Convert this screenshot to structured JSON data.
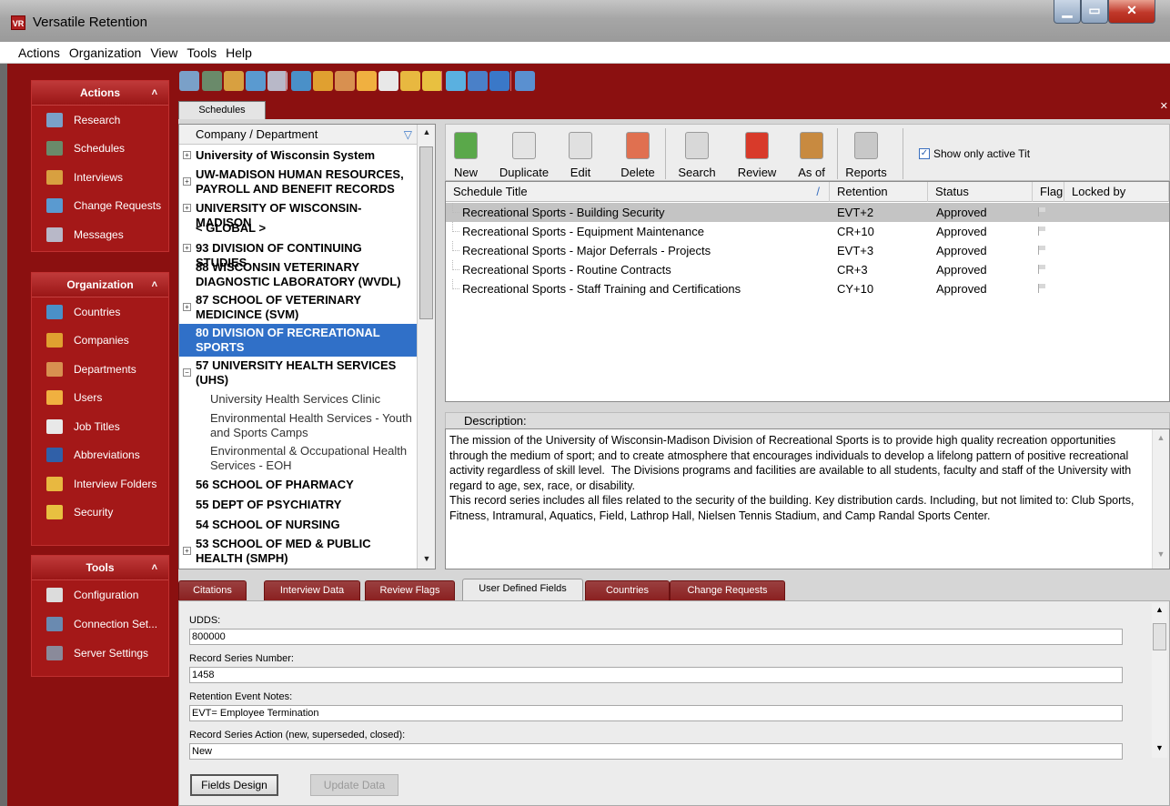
{
  "window": {
    "title": "Versatile Retention",
    "app_icon": "VR"
  },
  "menu": [
    "Actions",
    "Organization",
    "View",
    "Tools",
    "Help"
  ],
  "sidebar": {
    "panels": [
      {
        "title": "Actions",
        "items": [
          {
            "label": "Research",
            "icon": "research-icon",
            "color": "#7aa0c8"
          },
          {
            "label": "Schedules",
            "icon": "schedules-icon",
            "color": "#6a8a6a"
          },
          {
            "label": "Interviews",
            "icon": "interviews-icon",
            "color": "#d8a040"
          },
          {
            "label": "Change Requests",
            "icon": "change-requests-icon",
            "color": "#5a9ad0"
          },
          {
            "label": "Messages",
            "icon": "messages-icon",
            "color": "#b8b8c8"
          }
        ]
      },
      {
        "title": "Organization",
        "items": [
          {
            "label": "Countries",
            "icon": "globe-icon",
            "color": "#4a90c8"
          },
          {
            "label": "Companies",
            "icon": "companies-icon",
            "color": "#e0a030"
          },
          {
            "label": "Departments",
            "icon": "departments-icon",
            "color": "#d89050"
          },
          {
            "label": "Users",
            "icon": "users-icon",
            "color": "#f0b040"
          },
          {
            "label": "Job Titles",
            "icon": "job-titles-icon",
            "color": "#e8e8e8"
          },
          {
            "label": "Abbreviations",
            "icon": "abbreviations-icon",
            "color": "#3060a8"
          },
          {
            "label": "Interview Folders",
            "icon": "folders-icon",
            "color": "#e8b840"
          },
          {
            "label": "Security",
            "icon": "key-icon",
            "color": "#e8c040"
          }
        ]
      },
      {
        "title": "Tools",
        "items": [
          {
            "label": "Configuration",
            "icon": "wrench-icon",
            "color": "#dcdcdc"
          },
          {
            "label": "Connection Set...",
            "icon": "connection-icon",
            "color": "#6a8ab0"
          },
          {
            "label": "Server Settings",
            "icon": "server-icon",
            "color": "#8a8a9a"
          }
        ]
      }
    ]
  },
  "toolbar_icons": [
    {
      "icon": "research-icon",
      "color": "#7aa0c8"
    },
    {
      "icon": "schedules-icon",
      "color": "#6a8a6a"
    },
    {
      "icon": "interviews-icon",
      "color": "#d8a040"
    },
    {
      "icon": "change-requests-icon",
      "color": "#5a9ad0"
    },
    {
      "icon": "messages-icon",
      "color": "#b8b8c8"
    },
    {
      "icon": "globe-icon",
      "color": "#4a90c8"
    },
    {
      "icon": "companies-icon",
      "color": "#e0a030"
    },
    {
      "icon": "departments-icon",
      "color": "#d89050"
    },
    {
      "icon": "users-icon",
      "color": "#f0b040"
    },
    {
      "icon": "job-titles-icon",
      "color": "#e8e8e8"
    },
    {
      "icon": "folders-icon",
      "color": "#e8b840"
    },
    {
      "icon": "key-icon",
      "color": "#e8c040"
    },
    {
      "icon": "book-icon",
      "color": "#5ab0e0"
    },
    {
      "icon": "monitor-icon",
      "color": "#4a80c8"
    },
    {
      "icon": "info-icon",
      "color": "#3a78c8"
    },
    {
      "icon": "help-icon",
      "color": "#5a90d0"
    }
  ],
  "tabs": {
    "active": "Schedules"
  },
  "tree": {
    "header": "Company / Department",
    "nodes": [
      {
        "text": "University of Wisconsin System",
        "lines": 1,
        "expander": "+",
        "bold": true
      },
      {
        "text": "UW-MADISON HUMAN RESOURCES, PAYROLL AND BENEFIT RECORDS",
        "lines": 2,
        "expander": "+",
        "bold": true
      },
      {
        "text": "UNIVERSITY OF WISCONSIN-MADISON",
        "lines": 1,
        "expander": "+",
        "bold": true
      },
      {
        "text": "< GLOBAL >",
        "lines": 1,
        "expander": "",
        "bold": true
      },
      {
        "text": "93 DIVISION OF CONTINUING STUDIES",
        "lines": 1,
        "expander": "+",
        "bold": true
      },
      {
        "text": "88 WISCONSIN VETERINARY DIAGNOSTIC LABORATORY (WVDL)",
        "lines": 2,
        "expander": "",
        "bold": true
      },
      {
        "text": "87 SCHOOL OF VETERINARY MEDICINCE (SVM)",
        "lines": 2,
        "expander": "+",
        "bold": true
      },
      {
        "text": "80 DIVISION OF RECREATIONAL SPORTS",
        "lines": 2,
        "expander": "",
        "bold": true,
        "selected": true
      },
      {
        "text": "57 UNIVERSITY HEALTH SERVICES (UHS)",
        "lines": 2,
        "expander": "−",
        "bold": true
      },
      {
        "text": "University Health Services Clinic",
        "lines": 1,
        "expander": "",
        "child": true
      },
      {
        "text": "Environmental Health Services - Youth and Sports Camps",
        "lines": 2,
        "expander": "",
        "child": true
      },
      {
        "text": "Environmental & Occupational Health Services - EOH",
        "lines": 2,
        "expander": "",
        "child": true
      },
      {
        "text": "56 SCHOOL OF PHARMACY",
        "lines": 1,
        "expander": "",
        "bold": true
      },
      {
        "text": "55 DEPT OF PSYCHIATRY",
        "lines": 1,
        "expander": "",
        "bold": true
      },
      {
        "text": "54 SCHOOL OF NURSING",
        "lines": 1,
        "expander": "",
        "bold": true
      },
      {
        "text": "53 SCHOOL OF MED & PUBLIC HEALTH (SMPH)",
        "lines": 2,
        "expander": "+",
        "bold": true
      }
    ]
  },
  "action_buttons": [
    {
      "label": "New",
      "icon": "new-doc-icon",
      "color": "#5aa84a"
    },
    {
      "label": "Duplicate",
      "icon": "duplicate-icon",
      "color": "#e4e4e4"
    },
    {
      "label": "Edit",
      "icon": "edit-icon",
      "color": "#e0e0e0"
    },
    {
      "label": "Delete",
      "icon": "delete-icon",
      "color": "#e07050"
    },
    {
      "label": "Search",
      "icon": "search-icon",
      "color": "#d8d8d8"
    },
    {
      "label": "Review",
      "icon": "review-flag-icon",
      "color": "#d83a2a"
    },
    {
      "label": "As of",
      "icon": "as-of-icon",
      "color": "#c88a40"
    },
    {
      "label": "Reports",
      "icon": "printer-icon",
      "color": "#c8c8c8"
    }
  ],
  "show_active_label": "Show only active Tit",
  "show_active_checked": true,
  "grid": {
    "columns": [
      "Schedule Title",
      "Retention",
      "Status",
      "Flag",
      "Locked by"
    ],
    "rows": [
      {
        "title": "Recreational Sports - Building Security",
        "retention": "EVT+2",
        "status": "Approved",
        "selected": true
      },
      {
        "title": "Recreational Sports - Equipment Maintenance",
        "retention": "CR+10",
        "status": "Approved"
      },
      {
        "title": "Recreational Sports - Major Deferrals - Projects",
        "retention": "EVT+3",
        "status": "Approved"
      },
      {
        "title": "Recreational Sports - Routine Contracts",
        "retention": "CR+3",
        "status": "Approved"
      },
      {
        "title": "Recreational Sports - Staff Training and Certifications",
        "retention": "CY+10",
        "status": "Approved"
      }
    ]
  },
  "description": {
    "label": "Description:",
    "text": "The mission of the University of Wisconsin-Madison Division of Recreational Sports is to provide high quality recreation opportunities through the medium of sport; and to create atmosphere that encourages individuals to develop a lifelong pattern of positive recreational activity regardless of skill level.  The Divisions programs and facilities are available to all students, faculty and staff of the University with regard to age, sex, race, or disability.\nThis record series includes all files related to the security of the building. Key distribution cards. Including, but not limited to: Club Sports, Fitness, Intramural, Aquatics, Field, Lathrop Hall, Nielsen Tennis Stadium, and Camp Randal Sports Center."
  },
  "bottom_tabs": [
    "Citations",
    "Interview Data",
    "Review Flags",
    "User Defined Fields",
    "Countries",
    "Change Requests"
  ],
  "bottom_tab_active": "User Defined Fields",
  "fields": [
    {
      "label": "UDDS:",
      "value": "800000"
    },
    {
      "label": "Record Series Number:",
      "value": "1458"
    },
    {
      "label": "Retention Event Notes:",
      "value": "EVT= Employee Termination"
    },
    {
      "label": "Record Series Action (new, superseded, closed):",
      "value": "New"
    }
  ],
  "buttons": {
    "fields_design": "Fields Design",
    "update_data": "Update Data"
  }
}
